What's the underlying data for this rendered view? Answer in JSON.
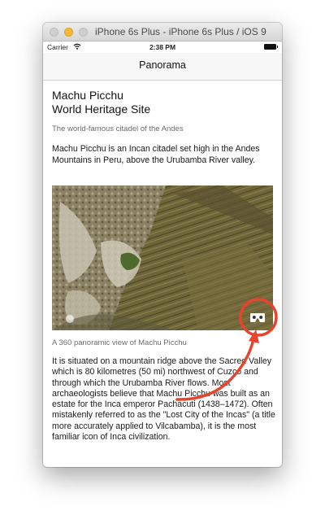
{
  "window": {
    "title": "iPhone 6s Plus - iPhone 6s Plus / iOS 9"
  },
  "status_bar": {
    "carrier": "Carrier",
    "time": "2:38 PM"
  },
  "nav": {
    "title": "Panorama"
  },
  "article": {
    "heading_line1": "Machu Picchu",
    "heading_line2": "World Heritage Site",
    "subtitle": "The world-famous citadel of the Andes",
    "intro": "Machu Picchu is an Incan citadel set high in the Andes Mountains in Peru, above the Urubamba River valley.",
    "caption": "A 360 panoramic view of Machu Picchu",
    "body": "It is situated on a mountain ridge above the Sacred Valley which is 80 kilometres (50 mi) northwest of Cuzco and through which the Urubamba River flows. Most archaeologists believe that Machu Picchu was built as an estate for the Inca emperor Pachacuti (1438–1472). Often mistakenly referred to as the \"Lost City of the Incas\" (a title more accurately applied to Vilcabamba), it is the most familiar icon of Inca civilization."
  },
  "icons": {
    "wifi": "wifi-icon",
    "battery": "battery-icon",
    "vr_mode": "cardboard-vr-icon",
    "info": "info-icon",
    "annotation": "red-arrow-annotation"
  },
  "colors": {
    "annotation_red": "#e8432e",
    "min_button": "#f5b938"
  }
}
